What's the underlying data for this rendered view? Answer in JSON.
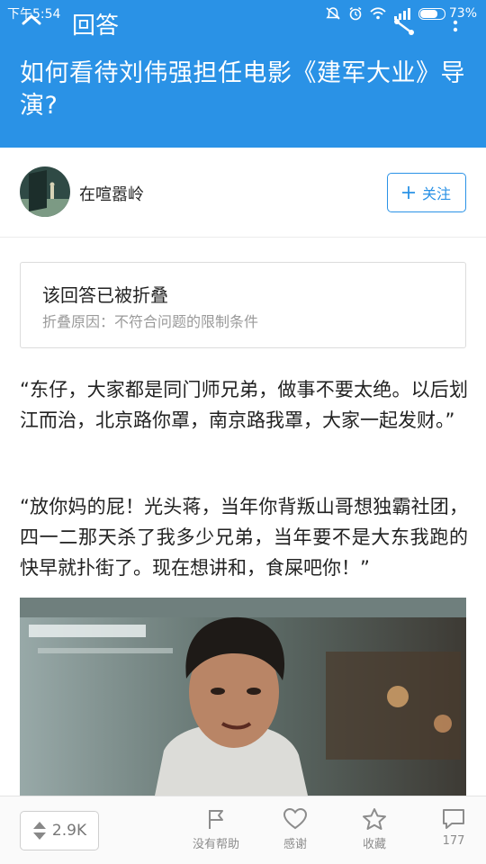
{
  "status_bar": {
    "time": "下午5:54",
    "battery": "73%",
    "battery_level": 0.73
  },
  "app_bar": {
    "title": "回答"
  },
  "question": {
    "title": "如何看待刘伟强担任电影《建军大业》导演?"
  },
  "author": {
    "name": "在喧嚣岭",
    "follow_label": "关注"
  },
  "folded_notice": {
    "title": "该回答已被折叠",
    "reason": "折叠原因：不符合问题的限制条件"
  },
  "answer": {
    "paragraphs": [
      "“东仔，大家都是同门师兄弟，做事不要太绝。以后划江而治，北京路你罩，南京路我罩，大家一起发财。”",
      "“放你妈的屁！光头蒋，当年你背叛山哥想独霸社团，四一二那天杀了我多少兄弟，当年要不是大东我跑的快早就扑街了。现在想讲和，食屎吧你！”"
    ]
  },
  "toolbar": {
    "vote_count": "2.9K",
    "unhelpful_label": "没有帮助",
    "thanks_label": "感谢",
    "collect_label": "收藏",
    "comment_count": "177"
  },
  "colors": {
    "brand": "#2a92e6",
    "text": "#222222",
    "muted": "#9a9a9a"
  }
}
